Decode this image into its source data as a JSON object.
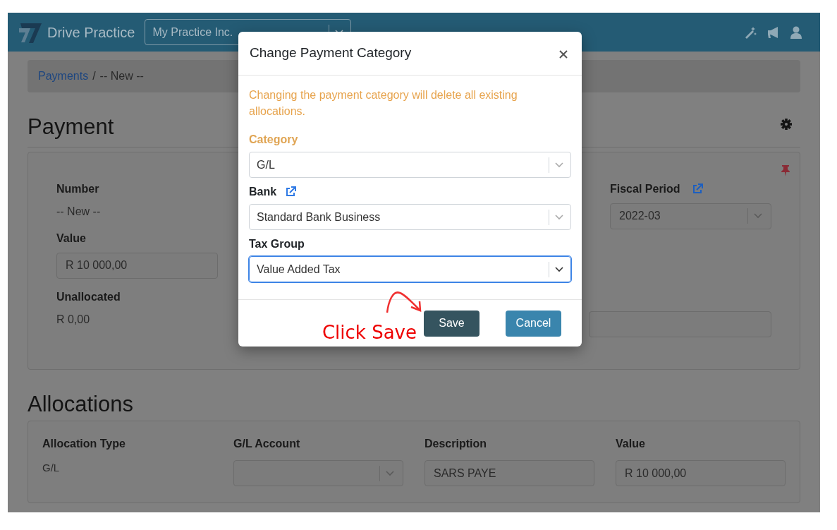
{
  "navbar": {
    "brand": "Drive Practice",
    "practice_select": {
      "value": "My Practice Inc."
    }
  },
  "breadcrumb": [
    {
      "label": "Payments",
      "kind": "link"
    },
    {
      "label": "/",
      "kind": "separator"
    },
    {
      "label": "-- New --",
      "kind": "current"
    }
  ],
  "page_title": "Payment",
  "payment_card": {
    "pinned": true,
    "fields": [
      {
        "label": "Number",
        "kind": "text",
        "value": "-- New --"
      },
      {
        "label": "Value",
        "kind": "input",
        "value": "R 10 000,00"
      },
      {
        "label": "Unallocated",
        "kind": "text",
        "value": "R 0,00"
      }
    ],
    "fiscal_period": {
      "label": "Fiscal Period",
      "value": "2022-03"
    }
  },
  "allocations": {
    "title": "Allocations",
    "columns": [
      "Allocation Type",
      "G/L Account",
      "Description",
      "Value"
    ],
    "rows": [
      {
        "cells": [
          {
            "kind": "text",
            "value": "G/L"
          },
          {
            "kind": "select"
          },
          {
            "kind": "input",
            "value": "SARS PAYE"
          },
          {
            "kind": "input",
            "value": "R 10 000,00"
          }
        ]
      }
    ]
  },
  "modal": {
    "title": "Change Payment Category",
    "warning": "Changing the payment category will delete all existing allocations.",
    "fields": [
      {
        "label": "Category",
        "warning": true,
        "link": false,
        "value": "G/L",
        "focused": false
      },
      {
        "label": "Bank",
        "warning": false,
        "link": true,
        "value": "Standard Bank Business",
        "focused": false
      },
      {
        "label": "Tax Group",
        "warning": false,
        "link": false,
        "value": "Value Added Tax",
        "focused": true
      }
    ],
    "buttons": [
      {
        "label": "Save",
        "kind": "primary"
      },
      {
        "label": "Cancel",
        "kind": "secondary"
      }
    ]
  },
  "annotation": {
    "text": "Click Save"
  }
}
